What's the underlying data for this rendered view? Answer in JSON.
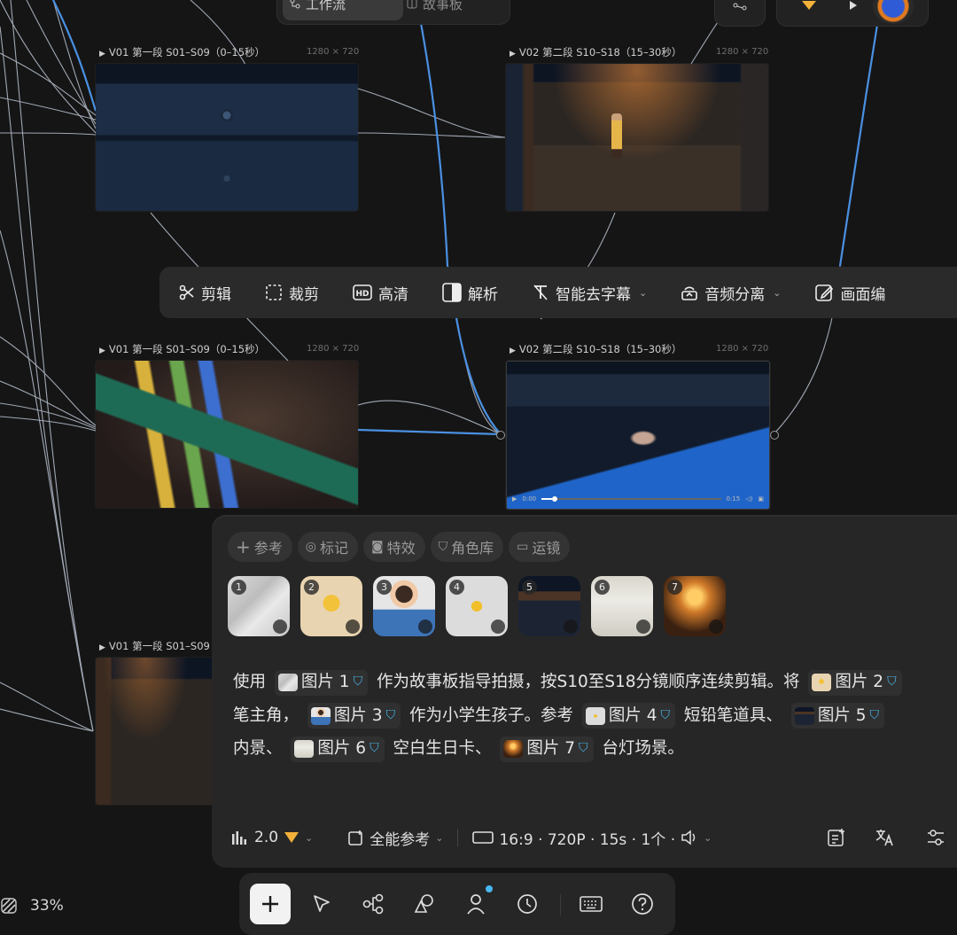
{
  "top_bar": {
    "workflow_tab": "工作流",
    "storyboard_tab": "故事板"
  },
  "nodes": [
    {
      "label": "V01 第一段 S01–S09（0–15秒）",
      "size": "1280 × 720",
      "image": "closed dark blue drawer"
    },
    {
      "label": "V02 第二段 S10–S18（15–30秒）",
      "size": "1280 × 720",
      "image": "pencil character in open drawer"
    },
    {
      "label": "V01 第一段 S01–S09（0–15秒）",
      "size": "1280 × 720",
      "image": "colored pencils in drawer"
    },
    {
      "label": "V02 第二段 S10–S18（15–30秒）",
      "size": "1280 × 720",
      "image": "child hand reaching into drawer",
      "video": {
        "current": "0:00",
        "duration": "0:15"
      }
    },
    {
      "label": "V01 第一段 S01–S09",
      "image": "open drawer"
    }
  ],
  "toolbar": {
    "items": [
      {
        "label": "剪辑",
        "icon": "scissors-icon"
      },
      {
        "label": "裁剪",
        "icon": "crop-icon"
      },
      {
        "label": "高清",
        "icon": "hd-icon"
      },
      {
        "label": "解析",
        "icon": "split-icon"
      },
      {
        "label": "智能去字幕",
        "icon": "remove-text-icon",
        "has_dropdown": true
      },
      {
        "label": "音频分离",
        "icon": "audio-separate-icon",
        "has_dropdown": true
      },
      {
        "label": "画面编",
        "icon": "edit-icon"
      }
    ]
  },
  "panel": {
    "chips": [
      {
        "label": "参考",
        "icon": "plus-icon"
      },
      {
        "label": "标记",
        "icon": "pin-icon"
      },
      {
        "label": "特效",
        "icon": "camera-icon"
      },
      {
        "label": "角色库",
        "icon": "shield-icon"
      },
      {
        "label": "运镜",
        "icon": "video-icon"
      }
    ],
    "references": [
      {
        "num": "1",
        "desc": "storyboard sketch"
      },
      {
        "num": "2",
        "desc": "pencil character"
      },
      {
        "num": "3",
        "desc": "student boy reading"
      },
      {
        "num": "4",
        "desc": "short pencil prop"
      },
      {
        "num": "5",
        "desc": "drawer interior"
      },
      {
        "num": "6",
        "desc": "blank birthday card"
      },
      {
        "num": "7",
        "desc": "desk lamp scene"
      }
    ],
    "prompt": {
      "line1": {
        "t1": "使用",
        "ref1": "图片 1",
        "t2": "作为故事板指导拍摄，按S10至S18分镜顺序连续剪辑。将",
        "ref2": "图片 2"
      },
      "line2": {
        "t1": "笔主角，",
        "ref3": "图片 3",
        "t2": "作为小学生孩子。参考",
        "ref4": "图片 4",
        "t3": "短铅笔道具、",
        "ref5": "图片 5"
      },
      "line3": {
        "t1": "内景、",
        "ref6": "图片 6",
        "t2": "空白生日卡、",
        "ref7": "图片 7",
        "t3": "台灯场景。"
      }
    },
    "footer": {
      "model": "2.0",
      "mode": "全能参考",
      "settings": "16:9 · 720P · 15s · 1个 ·"
    }
  },
  "zoom": "33%",
  "colors": {
    "background": "#151515",
    "panel": "#262626",
    "accent_blue": "#48b8f0",
    "badge_gold": "#f2b23a"
  }
}
